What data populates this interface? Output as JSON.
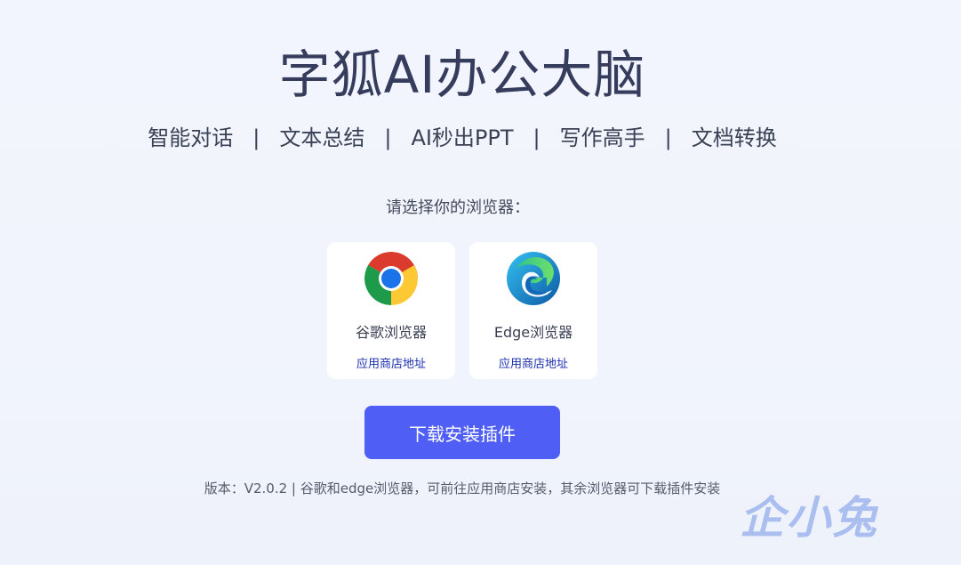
{
  "title": "字狐AI办公大脑",
  "features": [
    "智能对话",
    "文本总结",
    "AI秒出PPT",
    "写作高手",
    "文档转换"
  ],
  "separator": "|",
  "prompt": "请选择你的浏览器：",
  "browsers": [
    {
      "name": "谷歌浏览器",
      "icon": "chrome-icon",
      "store_label": "应用商店地址"
    },
    {
      "name": "Edge浏览器",
      "icon": "edge-icon",
      "store_label": "应用商店地址"
    }
  ],
  "download_label": "下载安装插件",
  "footer": "版本：V2.0.2 | 谷歌和edge浏览器，可前往应用商店安装，其余浏览器可下载插件安装",
  "watermark": "企小兔",
  "colors": {
    "accent": "#4f5ff5",
    "link": "#1a2fb0",
    "title": "#363c5c",
    "background": "#f2f5fd"
  }
}
